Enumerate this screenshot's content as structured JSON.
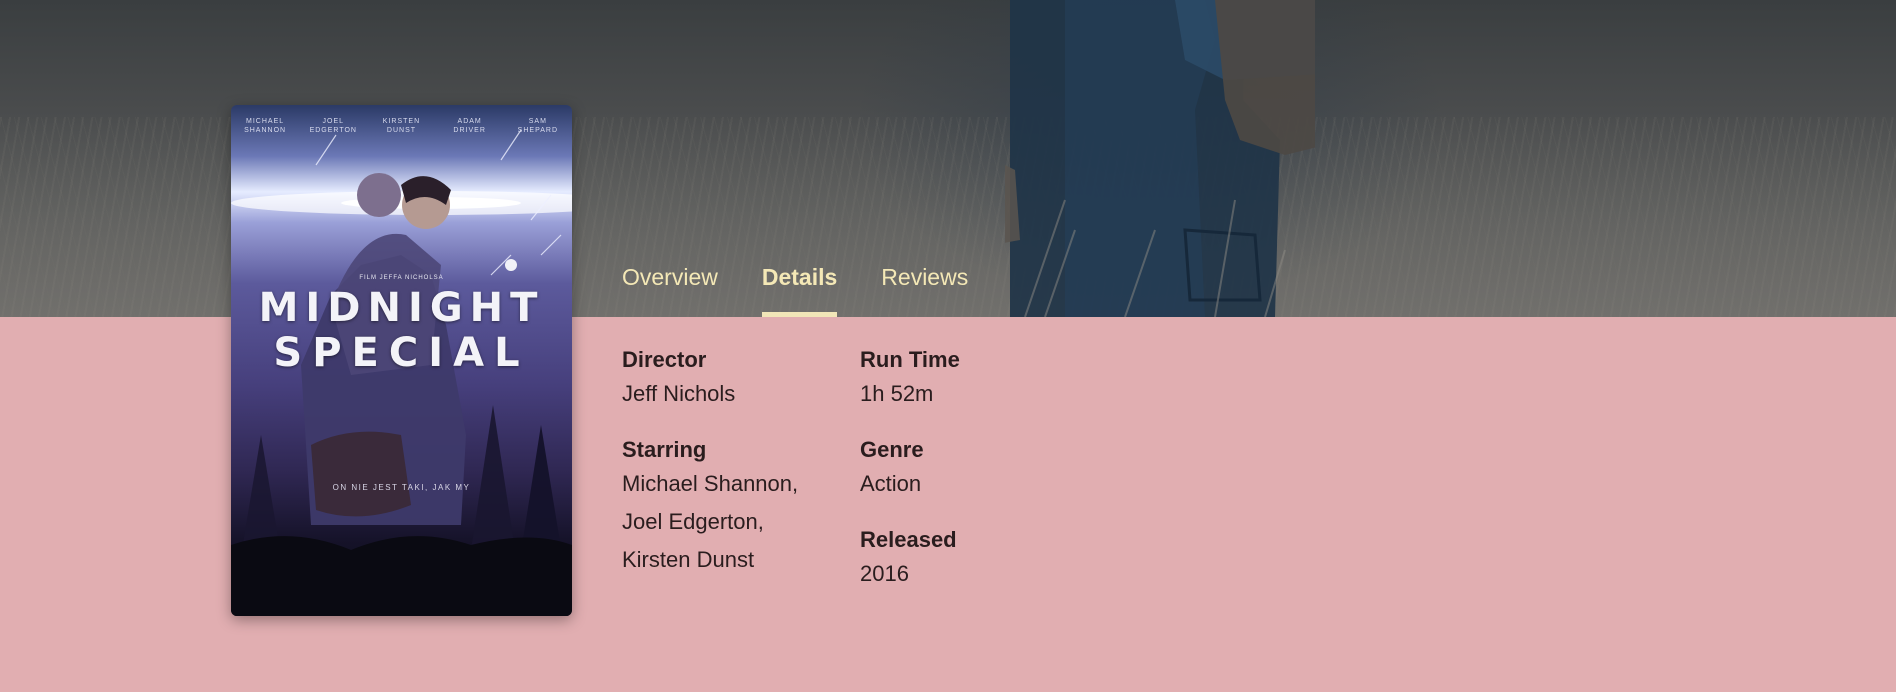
{
  "poster": {
    "credits": [
      {
        "first": "MICHAEL",
        "last": "SHANNON"
      },
      {
        "first": "JOEL",
        "last": "EDGERTON"
      },
      {
        "first": "KIRSTEN",
        "last": "DUNST"
      },
      {
        "first": "ADAM",
        "last": "DRIVER"
      },
      {
        "first": "SAM",
        "last": "SHEPARD"
      }
    ],
    "film_by": "FILM JEFFA NICHOLSA",
    "title_line1": "MIDNIGHT",
    "title_line2": "SPECIAL",
    "tagline": "ON NIE JEST TAKI, JAK MY"
  },
  "tabs": [
    {
      "label": "Overview",
      "active": false
    },
    {
      "label": "Details",
      "active": true
    },
    {
      "label": "Reviews",
      "active": false
    }
  ],
  "details": {
    "director": {
      "label": "Director",
      "value": "Jeff Nichols"
    },
    "starring": {
      "label": "Starring",
      "values": [
        "Michael Shannon,",
        "Joel Edgerton,",
        "Kirsten Dunst"
      ]
    },
    "run_time": {
      "label": "Run Time",
      "value": "1h 52m"
    },
    "genre": {
      "label": "Genre",
      "value": "Action"
    },
    "released": {
      "label": "Released",
      "value": "2016"
    }
  },
  "colors": {
    "background": "#e1aeb1",
    "tab_text": "#f4e8b6",
    "tab_indicator": "#f1e6b8",
    "body_text": "#2a1d1e"
  }
}
